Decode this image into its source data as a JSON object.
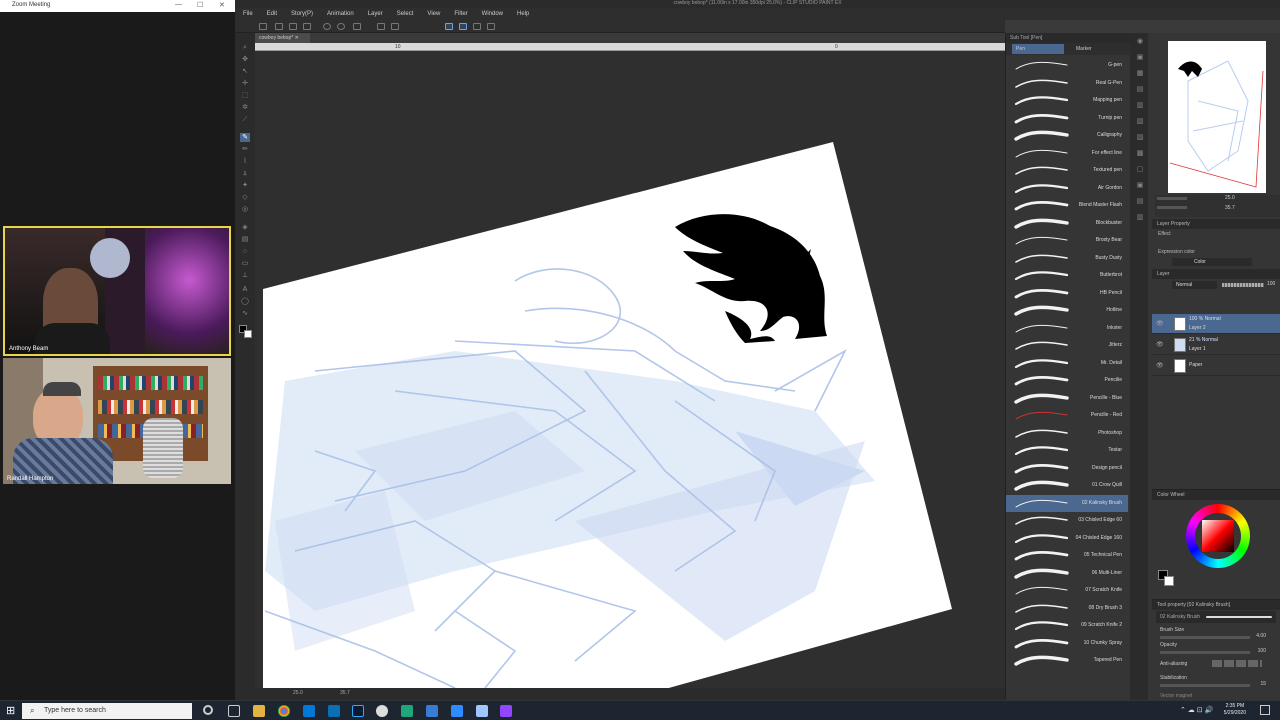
{
  "zoom": {
    "title": "Zoom Meeting",
    "participants": [
      {
        "name": "Anthony Beam"
      },
      {
        "name": "Randall Hampton"
      }
    ]
  },
  "csp": {
    "title": "cowboy bebop* (11.00in x 17.00in 350dpi 25.0%) - CLIP STUDIO PAINT EX",
    "menu": [
      "File",
      "Edit",
      "Story(P)",
      "Animation",
      "Layer",
      "Select",
      "View",
      "Filter",
      "Window",
      "Help"
    ],
    "doc_tab": "cowboy bebop*",
    "ruler_ticks": [
      "10",
      "0"
    ],
    "status_zoom": "25.0",
    "status_angle": "35.7"
  },
  "subtool": {
    "header": "Sub Tool [Pen]",
    "tabs": [
      "Pen",
      "Marker"
    ],
    "brushes": [
      "G-pen",
      "Real G-Pen",
      "Mapping pen",
      "Turnip pen",
      "Calligraphy",
      "For effect line",
      "Textured pen",
      "Air Gordon",
      "Blend Master Flash",
      "Blockbuster",
      "Brosty Bear",
      "Busty Dusty",
      "Butterbrot",
      "HB Pencil",
      "Hotline",
      "Inkster",
      "Jitterz",
      "Mr. Detail",
      "Pencilie",
      "Pencille - Blue",
      "Pencille - Red",
      "Photoshop",
      "Testar",
      "Design pencil",
      "01 Crow Quill",
      "02 Kalinsky Brush",
      "03 Chisled Edge 60",
      "04 Chisled Edge 160",
      "05 Technical Pen",
      "06 Multi-Liner",
      "07 Scratch Knife",
      "08 Dry Brush 3",
      "09 Scratch Knife 2",
      "10 Chunky Spray",
      "Tapered Pen"
    ],
    "selected_index": 25
  },
  "navigator": {
    "zoom": "25.0",
    "angle": "35.7"
  },
  "layers": {
    "header": "Layer Property",
    "effect_label": "Effect",
    "expression_label": "Expression color",
    "expression_value": "Color",
    "layer_tab": "Layer",
    "blend_mode": "Normal",
    "opacity": "100",
    "rows": [
      {
        "mode": "100 % Normal",
        "name": "Layer 2"
      },
      {
        "mode": "21 % Normal",
        "name": "Layer 1"
      },
      {
        "mode": "",
        "name": "Paper"
      }
    ]
  },
  "color": {
    "panel": "Color Wheel",
    "main": "#000000",
    "sub": "#ffffff"
  },
  "toolprop": {
    "header": "Tool property [02 Kalinsky Brush]",
    "brush_name": "02 Kalinsky Brush",
    "brush_size_label": "Brush Size",
    "brush_size": "4.00",
    "opacity_label": "Opacity",
    "opacity": "100",
    "aa_label": "Anti-aliasing",
    "stab_label": "Stabilization",
    "stab": "15",
    "vector_label": "Vector magnet"
  },
  "taskbar": {
    "search_placeholder": "Type here to search",
    "time": "2:35 PM",
    "date": "5/29/2020"
  }
}
